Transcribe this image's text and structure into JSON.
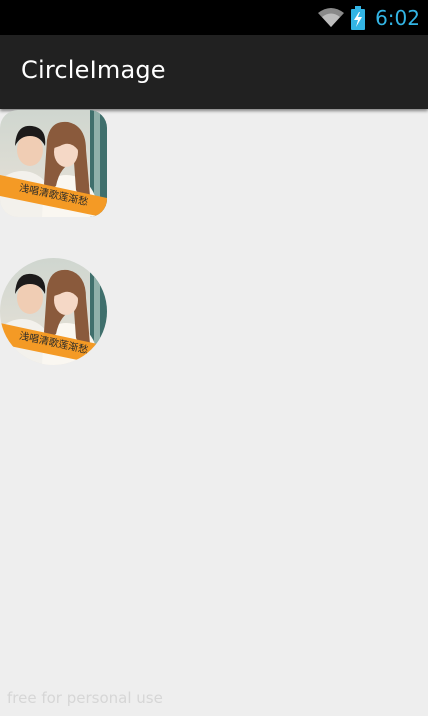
{
  "status_bar": {
    "time": "6:02",
    "icons": [
      "wifi-icon",
      "battery-charging-icon"
    ],
    "accent_color": "#33b5e5"
  },
  "action_bar": {
    "title": "CircleImage"
  },
  "images": [
    {
      "shape": "rounded-square",
      "banner_text": "浅唱清歌莲渐愁"
    },
    {
      "shape": "circle",
      "banner_text": "浅唱清歌莲渐愁"
    }
  ],
  "watermark": "free for personal use"
}
